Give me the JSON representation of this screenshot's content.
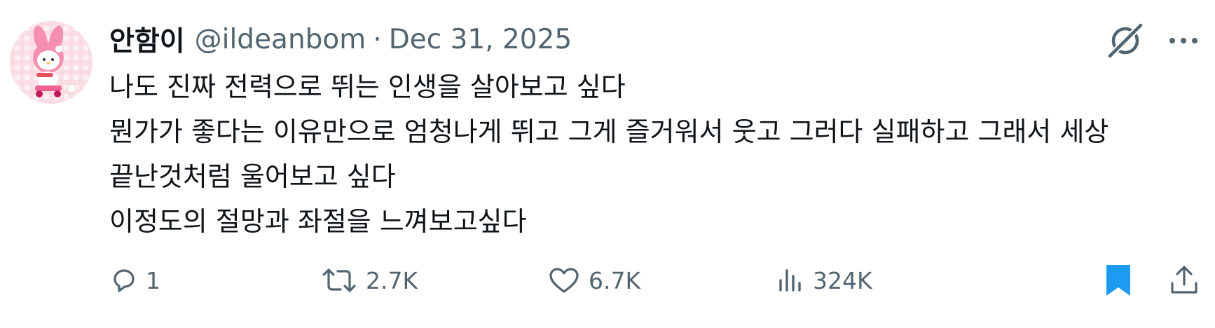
{
  "author": {
    "display_name": "안함이",
    "handle": "@ildeanbom",
    "separator": "·",
    "date": "Dec 31, 2025"
  },
  "tweet": {
    "lines": [
      "나도 진짜 전력으로 뛰는 인생을 살아보고 싶다",
      "뭔가가 좋다는 이유만으로 엄청나게 뛰고 그게 즐거워서 웃고 그러다 실패하고 그래서 세상",
      "끝난것처럼 울어보고 싶다",
      "이정도의 절망과 좌절을 느껴보고싶다"
    ]
  },
  "actions": {
    "reply": {
      "icon": "reply-icon",
      "count": "1"
    },
    "retweet": {
      "icon": "retweet-icon",
      "count": "2.7K"
    },
    "like": {
      "icon": "heart-icon",
      "count": "6.7K"
    },
    "views": {
      "icon": "views-icon",
      "count": "324K"
    },
    "bookmark": {
      "icon": "bookmark-icon",
      "active": true
    },
    "share": {
      "icon": "share-icon"
    }
  },
  "colors": {
    "text_primary": "#0f1419",
    "text_secondary": "#536471",
    "bookmark_active": "#1d9bf0",
    "avatar_bg": "#fbe3e6"
  }
}
